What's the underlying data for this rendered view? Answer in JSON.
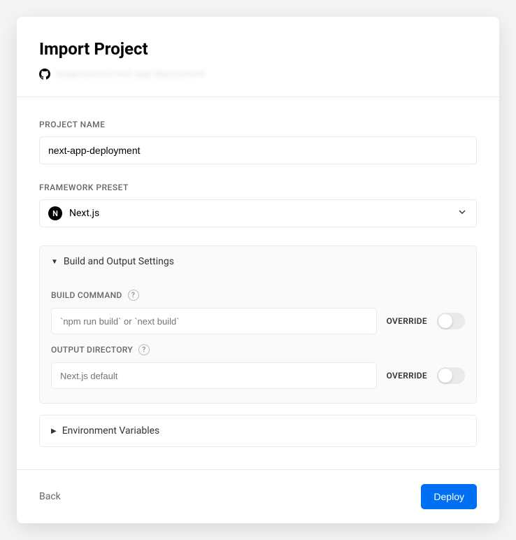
{
  "header": {
    "title": "Import Project",
    "repo": "beaprounovi/next-app-deployment"
  },
  "projectName": {
    "label": "PROJECT NAME",
    "value": "next-app-deployment"
  },
  "frameworkPreset": {
    "label": "FRAMEWORK PRESET",
    "selected": "Next.js"
  },
  "buildSettings": {
    "title": "Build and Output Settings",
    "buildCommand": {
      "label": "BUILD COMMAND",
      "placeholder": "`npm run build` or `next build`",
      "overrideLabel": "OVERRIDE"
    },
    "outputDirectory": {
      "label": "OUTPUT DIRECTORY",
      "placeholder": "Next.js default",
      "overrideLabel": "OVERRIDE"
    }
  },
  "envVars": {
    "title": "Environment Variables"
  },
  "footer": {
    "back": "Back",
    "deploy": "Deploy"
  }
}
